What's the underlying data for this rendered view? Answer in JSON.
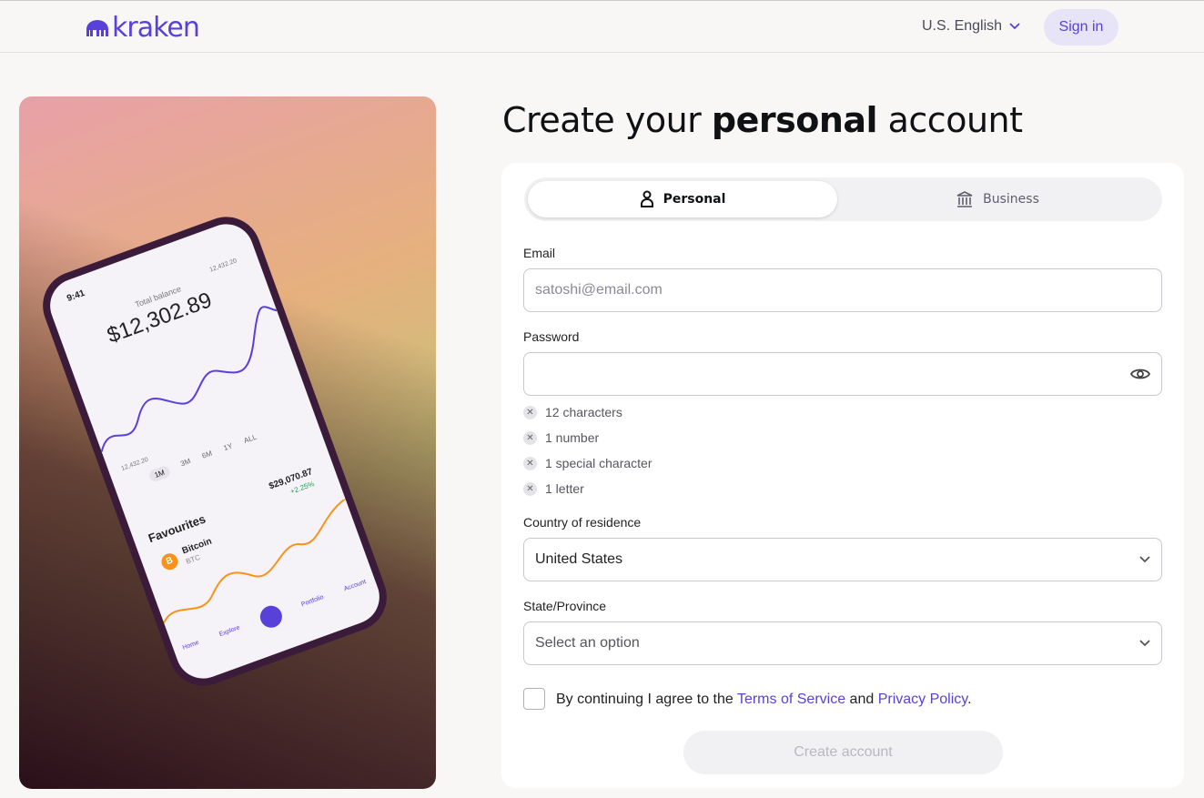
{
  "header": {
    "brand": "kraken",
    "language": "U.S. English",
    "sign_in": "Sign in"
  },
  "colors": {
    "brand": "#5741d9",
    "background": "#f8f7f6"
  },
  "phone": {
    "time": "9:41",
    "balance_label": "Total balance",
    "balance": "$12,302.89",
    "high": "12,432.20",
    "low": "12,432.20",
    "ranges": [
      "1M",
      "3M",
      "6M",
      "1Y",
      "ALL"
    ],
    "favourites": "Favourites",
    "coin": "Bitcoin",
    "ticker": "BTC",
    "price": "$29,070.87",
    "change": "+2.25%",
    "nav": [
      "Home",
      "Explore",
      "Portfolio",
      "Account"
    ]
  },
  "page": {
    "title_pre": "Create your ",
    "title_bold": "personal",
    "title_post": " account"
  },
  "tabs": [
    {
      "label": "Personal",
      "icon": "person-icon",
      "active": true
    },
    {
      "label": "Business",
      "icon": "bank-icon",
      "active": false
    }
  ],
  "form": {
    "email_label": "Email",
    "email_placeholder": "satoshi@email.com",
    "password_label": "Password",
    "password_rules": [
      "12 characters",
      "1 number",
      "1 special character",
      "1 letter"
    ],
    "country_label": "Country of residence",
    "country_value": "United States",
    "state_label": "State/Province",
    "state_placeholder": "Select an option",
    "agree_pre": "By continuing I agree to the ",
    "terms": "Terms of Service",
    "agree_mid": " and ",
    "privacy": "Privacy Policy",
    "agree_post": ".",
    "submit": "Create account"
  }
}
